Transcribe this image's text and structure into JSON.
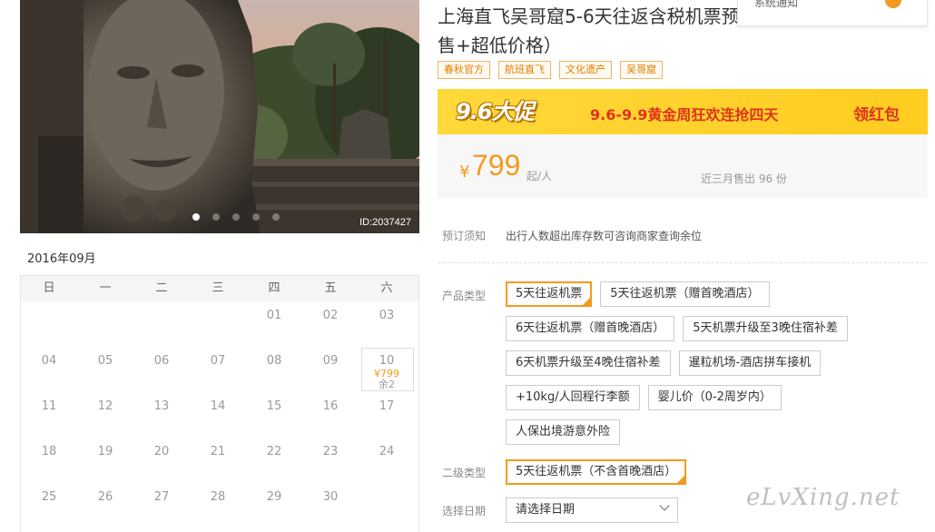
{
  "hero": {
    "image_id": "ID:2037427",
    "slides": 5,
    "active_slide": 1
  },
  "calendar": {
    "month": "2016年09月",
    "weekdays": [
      "日",
      "一",
      "二",
      "三",
      "四",
      "五",
      "六"
    ],
    "weeks": [
      [
        {
          "d": ""
        },
        {
          "d": ""
        },
        {
          "d": ""
        },
        {
          "d": ""
        },
        {
          "d": "01"
        },
        {
          "d": "02"
        },
        {
          "d": "03"
        }
      ],
      [
        {
          "d": "04"
        },
        {
          "d": "05"
        },
        {
          "d": "06"
        },
        {
          "d": "07"
        },
        {
          "d": "08"
        },
        {
          "d": "09"
        },
        {
          "d": "10",
          "price": "¥799",
          "stock": "余2"
        }
      ],
      [
        {
          "d": "11"
        },
        {
          "d": "12"
        },
        {
          "d": "13"
        },
        {
          "d": "14"
        },
        {
          "d": "15"
        },
        {
          "d": "16"
        },
        {
          "d": "17"
        }
      ],
      [
        {
          "d": "18"
        },
        {
          "d": "19"
        },
        {
          "d": "20"
        },
        {
          "d": "21"
        },
        {
          "d": "22"
        },
        {
          "d": "23"
        },
        {
          "d": "24"
        }
      ],
      [
        {
          "d": "25"
        },
        {
          "d": "26"
        },
        {
          "d": "27"
        },
        {
          "d": "28"
        },
        {
          "d": "29"
        },
        {
          "d": "30"
        },
        {
          "d": ""
        }
      ]
    ]
  },
  "product": {
    "title": "上海直飞吴哥窟5-6天往返含税机票预售+超低价格）",
    "tags": [
      "春秋官方",
      "航班直飞",
      "文化遗产",
      "吴哥窟"
    ]
  },
  "notice_dropdown": {
    "label": "系统通知"
  },
  "banner": {
    "logo": "9.6大促",
    "text": "9.6-9.9黄金周狂欢连抢四天",
    "button": "领红包",
    "colors": {
      "bg": "#ffd83a",
      "text": "#e0331d"
    }
  },
  "price": {
    "currency": "¥",
    "value": "799",
    "unit": "起/人",
    "sold": "近三月售出 96 份"
  },
  "booking": {
    "notice_label": "预订须知",
    "notice_text": "出行人数超出库存数可咨询商家查询余位",
    "type_label": "产品类型",
    "options": [
      {
        "label": "5天往返机票",
        "selected": true
      },
      {
        "label": "5天往返机票（赠首晚酒店）",
        "selected": false
      },
      {
        "label": "6天往返机票（赠首晚酒店）",
        "selected": false
      },
      {
        "label": "5天机票升级至3晚住宿补差",
        "selected": false
      },
      {
        "label": "6天机票升级至4晚住宿补差",
        "selected": false
      },
      {
        "label": "暹粒机场-酒店拼车接机",
        "selected": false
      },
      {
        "label": "+10kg/人回程行李额",
        "selected": false
      },
      {
        "label": "婴儿价（0-2周岁内）",
        "selected": false
      },
      {
        "label": "人保出境游意外险",
        "selected": false
      }
    ],
    "sub_label": "二级类型",
    "sub_option": "5天往返机票（不含首晚酒店）",
    "date_label": "选择日期",
    "date_placeholder": "请选择日期"
  },
  "watermark": "eLvXing.net",
  "colors": {
    "accent": "#f39a1e"
  }
}
